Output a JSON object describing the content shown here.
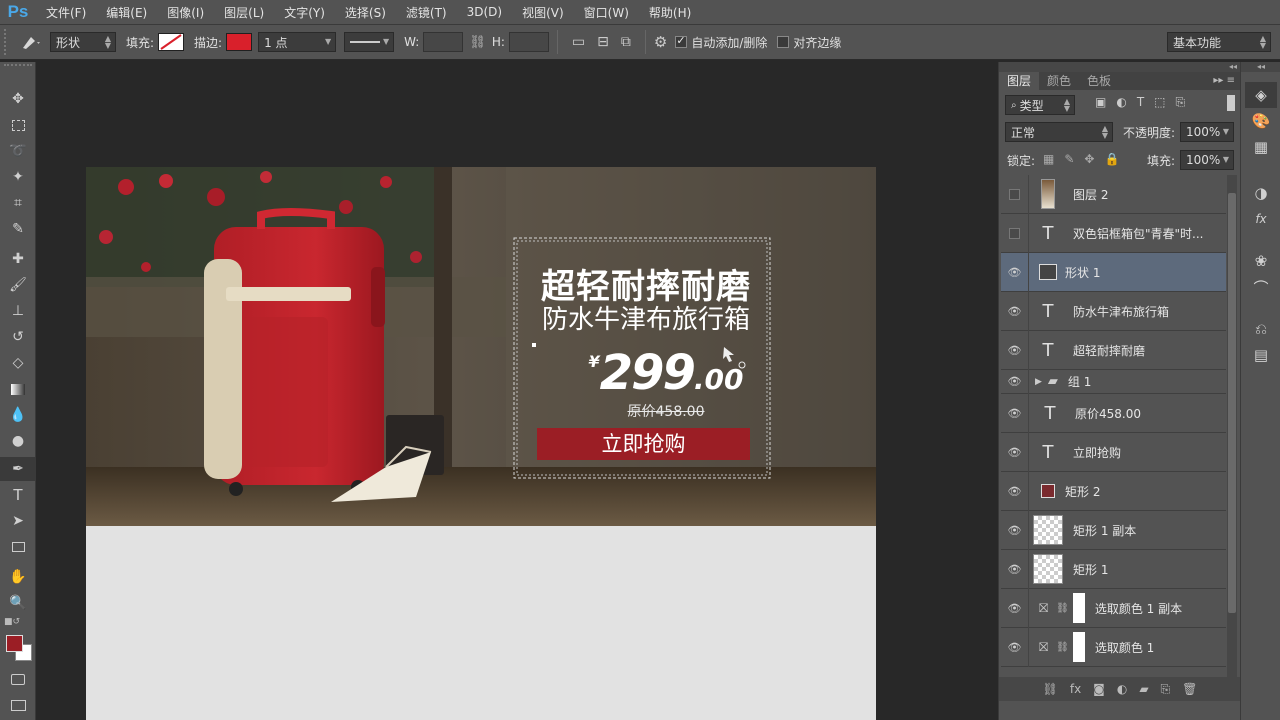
{
  "app": {
    "logo": "Ps"
  },
  "menu": [
    "文件(F)",
    "编辑(E)",
    "图像(I)",
    "图层(L)",
    "文字(Y)",
    "选择(S)",
    "滤镜(T)",
    "3D(D)",
    "视图(V)",
    "窗口(W)",
    "帮助(H)"
  ],
  "options": {
    "tool_mode": "形状",
    "fill_label": "填充:",
    "stroke_label": "描边:",
    "stroke_color": "#d9202b",
    "stroke_width": "1 点",
    "w_label": "W:",
    "h_label": "H:",
    "auto_add_delete": "自动添加/删除",
    "auto_add_delete_checked": true,
    "align_edges": "对齐边缘",
    "align_edges_checked": false,
    "workspace": "基本功能"
  },
  "tools": [
    "move-icon",
    "marquee-icon",
    "lasso-icon",
    "magic-wand-icon",
    "crop-icon",
    "eyedropper-icon",
    "healing-icon",
    "brush-icon",
    "clone-stamp-icon",
    "history-brush-icon",
    "eraser-icon",
    "gradient-icon",
    "blur-icon",
    "dodge-icon",
    "pen-icon",
    "type-icon",
    "path-select-icon",
    "shape-icon",
    "hand-icon",
    "zoom-icon"
  ],
  "colors": {
    "foreground": "#9b1e25",
    "background": "#ffffff",
    "accent_select": "#5d6a7c"
  },
  "banner": {
    "title": "超轻耐摔耐磨",
    "subtitle": "防水牛津布旅行箱",
    "currency": "¥",
    "price_int": "299",
    "price_dec": ".00",
    "original_price": "原价458.00",
    "buy_button": "立即抢购"
  },
  "panel": {
    "tabs": [
      "图层",
      "颜色",
      "色板"
    ],
    "filter_kind": "类型",
    "blend_mode": "正常",
    "opacity_label": "不透明度:",
    "opacity": "100%",
    "lock_label": "锁定:",
    "fill_label": "填充:",
    "fill": "100%"
  },
  "layers": [
    {
      "name": "图层 2",
      "kind": "image",
      "visible": false,
      "selected": false
    },
    {
      "name": "双色铝框箱包\"青春\"时...",
      "kind": "text",
      "visible": false,
      "selected": false
    },
    {
      "name": "形状 1",
      "kind": "shape",
      "visible": true,
      "selected": true
    },
    {
      "name": "防水牛津布旅行箱",
      "kind": "text",
      "visible": true,
      "selected": false
    },
    {
      "name": "超轻耐摔耐磨",
      "kind": "text",
      "visible": true,
      "selected": false
    },
    {
      "name": "组 1",
      "kind": "group",
      "visible": true,
      "selected": false
    },
    {
      "name": "原价458.00",
      "kind": "text",
      "visible": true,
      "selected": false
    },
    {
      "name": "立即抢购",
      "kind": "text",
      "visible": true,
      "selected": false
    },
    {
      "name": "矩形 2",
      "kind": "shape",
      "visible": true,
      "selected": false
    },
    {
      "name": "矩形 1 副本",
      "kind": "checker-shape",
      "visible": true,
      "selected": false
    },
    {
      "name": "矩形 1",
      "kind": "checker-shape",
      "visible": true,
      "selected": false
    },
    {
      "name": "选取颜色 1 副本",
      "kind": "adjustment",
      "visible": true,
      "selected": false
    },
    {
      "name": "选取颜色 1",
      "kind": "adjustment",
      "visible": true,
      "selected": false
    }
  ]
}
